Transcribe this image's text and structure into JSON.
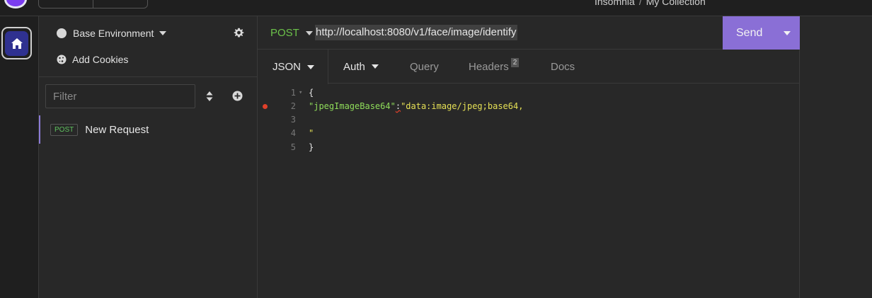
{
  "app": {
    "title": "Insomnia",
    "collection": "My Collection",
    "separator": "/"
  },
  "sidebar": {
    "environment_label": "Base Environment",
    "cookies_label": "Add Cookies",
    "filter_placeholder": "Filter",
    "requests": [
      {
        "method": "POST",
        "name": "New Request"
      }
    ]
  },
  "request": {
    "method": "POST",
    "url": "http://localhost:8080/v1/face/image/identify",
    "send_label": "Send"
  },
  "tabs": {
    "body": "JSON",
    "auth": "Auth",
    "query": "Query",
    "headers": "Headers",
    "headers_count": "2",
    "docs": "Docs"
  },
  "editor": {
    "line_numbers": [
      "1",
      "2",
      "3",
      "4",
      "5"
    ],
    "line1": "{",
    "line2_key": "\"jpegImageBase64\"",
    "line2_colon": ":",
    "line2_value": "\"data:image/jpeg;base64,",
    "line4": "\"",
    "line5": "}"
  },
  "colors": {
    "accent": "#8a6fd6",
    "post": "#6cc24a",
    "string": "#e5e055",
    "error": "#e0402a"
  }
}
